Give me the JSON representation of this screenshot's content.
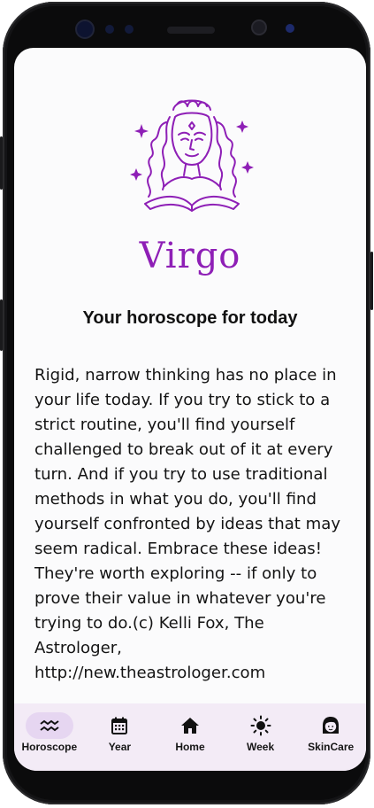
{
  "sign": {
    "name": "Virgo",
    "accent_color": "#8e1fb6",
    "illustration": "virgo-maiden-illustration"
  },
  "horoscope": {
    "heading": "Your horoscope for today",
    "body": "Rigid, narrow thinking has no place in your life today. If you try to stick to a strict routine, you'll find yourself challenged to break out of it at every turn. And if you try to use traditional methods in what you do, you'll find yourself confronted by ideas that may seem radical. Embrace these ideas! They're worth exploring -- if only to prove their value in whatever you're trying to do.(c) Kelli Fox, The Astrologer, http://new.theastrologer.com"
  },
  "nav": {
    "active": "Horoscope",
    "items": [
      {
        "label": "Horoscope",
        "icon": "aquarius-waves-icon"
      },
      {
        "label": "Year",
        "icon": "calendar-icon"
      },
      {
        "label": "Home",
        "icon": "home-icon"
      },
      {
        "label": "Week",
        "icon": "sun-icon"
      },
      {
        "label": "SkinCare",
        "icon": "face-icon"
      }
    ]
  }
}
